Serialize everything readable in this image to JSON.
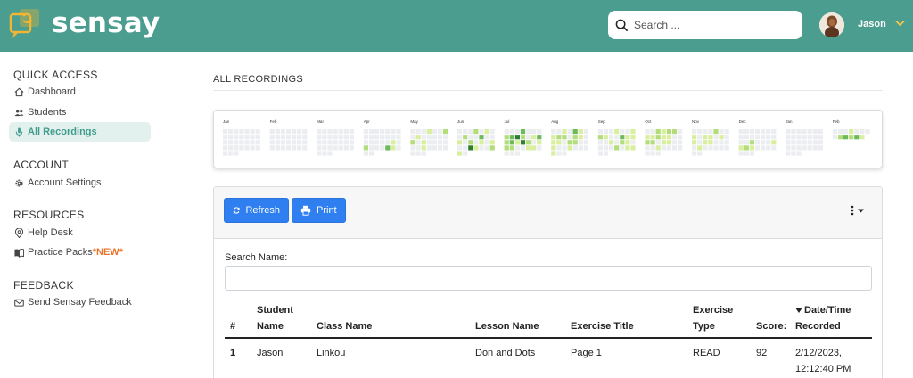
{
  "brand": {
    "name": "sensay"
  },
  "search": {
    "placeholder": "Search ..."
  },
  "user": {
    "name": "Jason"
  },
  "sidebar": {
    "sections": [
      {
        "title": "QUICK ACCESS",
        "items": [
          {
            "label": "Dashboard",
            "icon": "home-icon"
          },
          {
            "label": "Students",
            "icon": "users-icon"
          },
          {
            "label": "All Recordings",
            "icon": "microphone-icon",
            "active": true
          }
        ]
      },
      {
        "title": "ACCOUNT",
        "items": [
          {
            "label": "Account Settings",
            "icon": "gear-icon"
          }
        ]
      },
      {
        "title": "RESOURCES",
        "items": [
          {
            "label": "Help Desk",
            "icon": "map-pin-icon"
          },
          {
            "label": "Practice Packs",
            "badge": "*NEW*",
            "icon": "book-icon"
          }
        ]
      },
      {
        "title": "FEEDBACK",
        "items": [
          {
            "label": "Send Sensay Feedback",
            "icon": "envelope-icon"
          }
        ]
      }
    ]
  },
  "page": {
    "title": "ALL RECORDINGS"
  },
  "heatmap": {
    "colors": {
      "empty": "#ebedf0",
      "l1": "#d9ef9f",
      "l2": "#b2dd7a",
      "l3": "#6cba5a",
      "l4": "#2e7d32"
    },
    "months": [
      {
        "label": "Jan",
        "levels": [
          0,
          0,
          0,
          0,
          0,
          0,
          0,
          0,
          0,
          0,
          0,
          0,
          0,
          0,
          0,
          0,
          0,
          0,
          0,
          0,
          0,
          0,
          0,
          0,
          0,
          0,
          0,
          0,
          0,
          0,
          0
        ]
      },
      {
        "label": "Feb",
        "levels": [
          0,
          0,
          0,
          0,
          0,
          0,
          0,
          0,
          0,
          0,
          0,
          0,
          0,
          0,
          0,
          0,
          0,
          0,
          0,
          0,
          0,
          0,
          0,
          0,
          0,
          0,
          0,
          0
        ]
      },
      {
        "label": "Mar",
        "levels": [
          0,
          0,
          0,
          0,
          0,
          0,
          0,
          0,
          0,
          0,
          0,
          0,
          0,
          0,
          0,
          0,
          0,
          0,
          0,
          0,
          0,
          0,
          0,
          0,
          0,
          0,
          0,
          0,
          0,
          0,
          0
        ]
      },
      {
        "label": "Apr",
        "levels": [
          0,
          0,
          0,
          0,
          0,
          0,
          0,
          0,
          0,
          0,
          0,
          0,
          0,
          0,
          0,
          0,
          0,
          0,
          0,
          1,
          0,
          2,
          0,
          0,
          0,
          3,
          1,
          0,
          0,
          0
        ]
      },
      {
        "label": "May",
        "levels": [
          0,
          0,
          0,
          1,
          0,
          0,
          2,
          0,
          1,
          0,
          0,
          0,
          0,
          0,
          2,
          0,
          1,
          0,
          0,
          0,
          0,
          0,
          0,
          1,
          0,
          0,
          0,
          0,
          0,
          0,
          0
        ]
      },
      {
        "label": "Jun",
        "levels": [
          0,
          0,
          0,
          2,
          0,
          1,
          0,
          0,
          2,
          0,
          0,
          3,
          0,
          0,
          1,
          0,
          2,
          0,
          1,
          0,
          1,
          0,
          0,
          4,
          1,
          0,
          0,
          2,
          1,
          0
        ]
      },
      {
        "label": "Jul",
        "levels": [
          0,
          0,
          0,
          3,
          0,
          0,
          0,
          2,
          3,
          4,
          2,
          0,
          1,
          3,
          2,
          3,
          1,
          4,
          2,
          0,
          1,
          2,
          2,
          0,
          0,
          1,
          1,
          0,
          0,
          0,
          0
        ]
      },
      {
        "label": "Aug",
        "levels": [
          0,
          0,
          1,
          0,
          3,
          1,
          0,
          1,
          2,
          2,
          0,
          2,
          1,
          0,
          1,
          1,
          0,
          2,
          2,
          0,
          0,
          1,
          0,
          0,
          1,
          0,
          0,
          0,
          1,
          0,
          0
        ]
      },
      {
        "label": "Sep",
        "levels": [
          0,
          0,
          0,
          1,
          0,
          0,
          1,
          2,
          1,
          0,
          0,
          3,
          1,
          1,
          0,
          0,
          1,
          0,
          2,
          1,
          0,
          0,
          0,
          0,
          2,
          0,
          1,
          1,
          0,
          0
        ]
      },
      {
        "label": "Oct",
        "levels": [
          0,
          0,
          2,
          1,
          2,
          2,
          0,
          1,
          1,
          2,
          1,
          1,
          0,
          0,
          2,
          2,
          0,
          1,
          1,
          0,
          0,
          0,
          0,
          1,
          0,
          0,
          0,
          0,
          0,
          0,
          0
        ]
      },
      {
        "label": "Nov",
        "levels": [
          0,
          0,
          0,
          0,
          2,
          0,
          0,
          1,
          0,
          1,
          1,
          0,
          1,
          0,
          1,
          0,
          1,
          1,
          0,
          0,
          0,
          0,
          1,
          0,
          0,
          0,
          0,
          0,
          0,
          0
        ]
      },
      {
        "label": "Dec",
        "levels": [
          0,
          0,
          0,
          0,
          0,
          0,
          0,
          0,
          0,
          0,
          0,
          0,
          0,
          0,
          0,
          0,
          2,
          0,
          0,
          0,
          1,
          1,
          2,
          1,
          0,
          0,
          0,
          0,
          0,
          0,
          0
        ]
      },
      {
        "label": "Jan",
        "levels": [
          0,
          0,
          0,
          0,
          0,
          0,
          0,
          0,
          0,
          0,
          0,
          0,
          0,
          0,
          0,
          0,
          0,
          0,
          0,
          0,
          0,
          0,
          0,
          0,
          0,
          0,
          0,
          0,
          0,
          0,
          0
        ]
      },
      {
        "label": "Feb",
        "levels": [
          0,
          0,
          0,
          1,
          0,
          0,
          0,
          0,
          2,
          3,
          2,
          3,
          1
        ]
      }
    ]
  },
  "toolbar": {
    "refresh_label": "Refresh",
    "print_label": "Print"
  },
  "filter": {
    "label": "Search Name:",
    "value": ""
  },
  "table": {
    "columns": {
      "index": "#",
      "student_line1": "Student",
      "student_line2": "Name",
      "class": "Class Name",
      "lesson": "Lesson Name",
      "exercise": "Exercise Title",
      "type_line1": "Exercise",
      "type_line2": "Type",
      "score": "Score:",
      "date_line1": "Date/Time",
      "date_line2": "Recorded"
    },
    "rows": [
      {
        "index": "1",
        "student": "Jason",
        "class": "Linkou",
        "lesson": "Don and Dots",
        "exercise": "Page 1",
        "type": "READ",
        "score": "92",
        "date_line1": "2/12/2023,",
        "date_line2": "12:12:40 PM"
      }
    ]
  }
}
